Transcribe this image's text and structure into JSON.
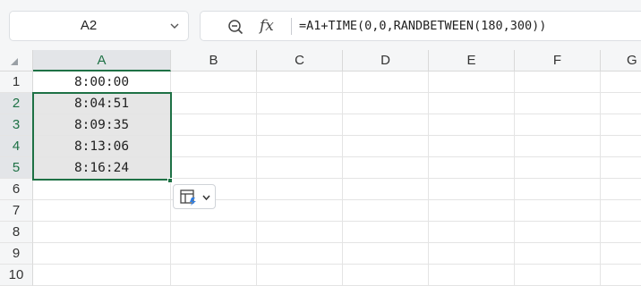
{
  "name_box": {
    "value": "A2"
  },
  "formula_bar": {
    "zoom_icon": "zoom-magnifier-icon",
    "fx_label": "fx",
    "formula": "=A1+TIME(0,0,RANDBETWEEN(180,300))"
  },
  "columns": [
    "A",
    "B",
    "C",
    "D",
    "E",
    "F",
    "G"
  ],
  "rows": [
    "1",
    "2",
    "3",
    "4",
    "5",
    "6",
    "7",
    "8",
    "9",
    "10"
  ],
  "cells": {
    "A1": "8:00:00",
    "A2": "8:04:51",
    "A3": "8:09:35",
    "A4": "8:13:06",
    "A5": "8:16:24"
  },
  "paste_options": {
    "icon": "paste-options-icon"
  },
  "colors": {
    "accent": "#1e7145",
    "selection_fill": "#e6e6e6"
  }
}
